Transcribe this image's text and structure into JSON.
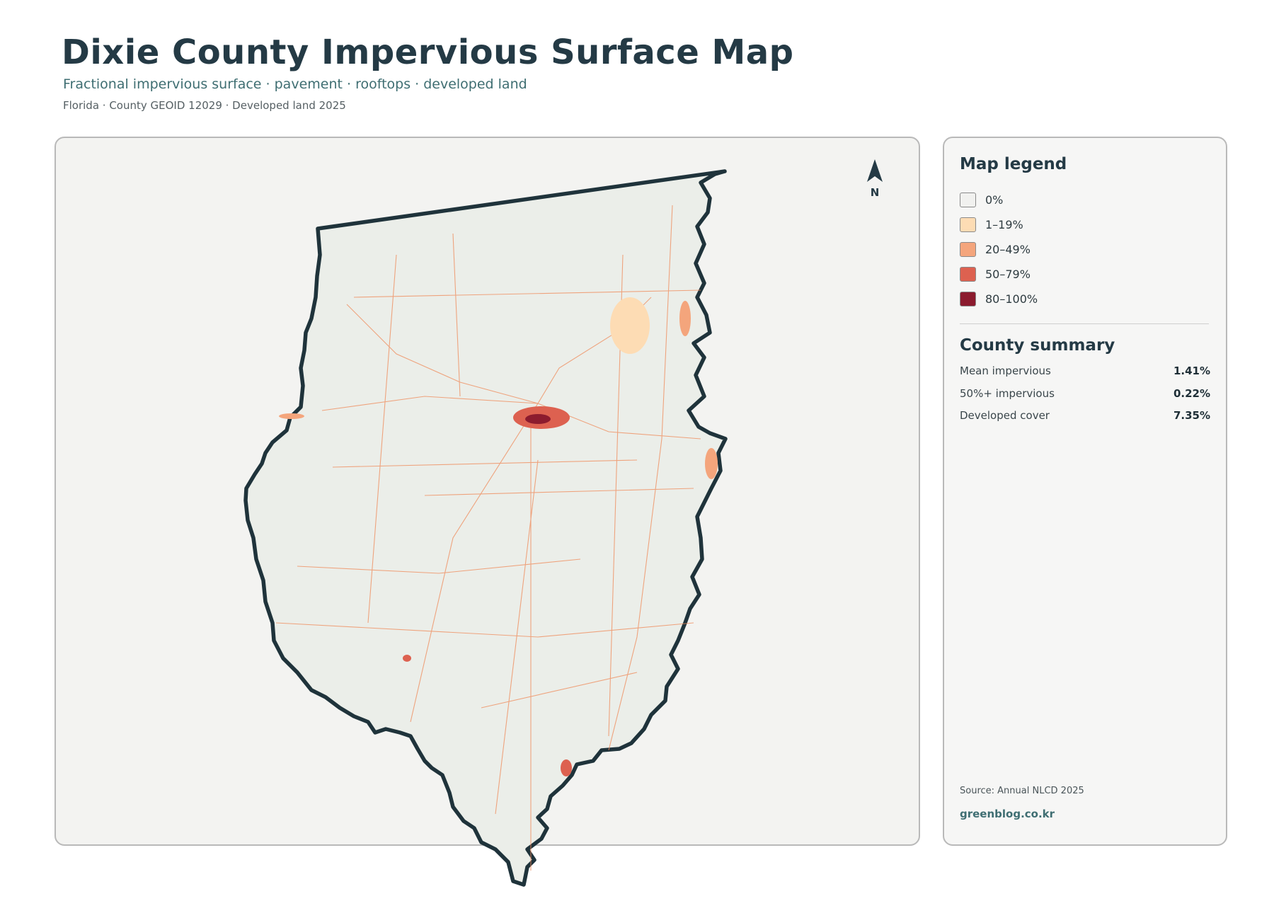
{
  "header": {
    "title": "Dixie County Impervious Surface Map",
    "subtitle": "Fractional impervious surface · pavement · rooftops · developed land",
    "meta": "Florida · County GEOID 12029 · Developed land 2025"
  },
  "map": {
    "north_label": "N",
    "fill_color": "#ebeee9",
    "outline_color": "#1f333b",
    "road_color": "#ef8a5a"
  },
  "legend": {
    "title": "Map legend",
    "items": [
      {
        "label": "0%",
        "color": "#f1f1ef"
      },
      {
        "label": "1–19%",
        "color": "#fddcb4"
      },
      {
        "label": "20–49%",
        "color": "#f4a57c"
      },
      {
        "label": "50–79%",
        "color": "#dd6150"
      },
      {
        "label": "80–100%",
        "color": "#8c1b2e"
      }
    ]
  },
  "summary": {
    "title": "County summary",
    "rows": [
      {
        "label": "Mean impervious",
        "value": "1.41%"
      },
      {
        "label": "50%+ impervious",
        "value": "0.22%"
      },
      {
        "label": "Developed cover",
        "value": "7.35%"
      }
    ]
  },
  "footer": {
    "source": "Source: Annual NLCD 2025",
    "site": "greenblog.co.kr"
  }
}
